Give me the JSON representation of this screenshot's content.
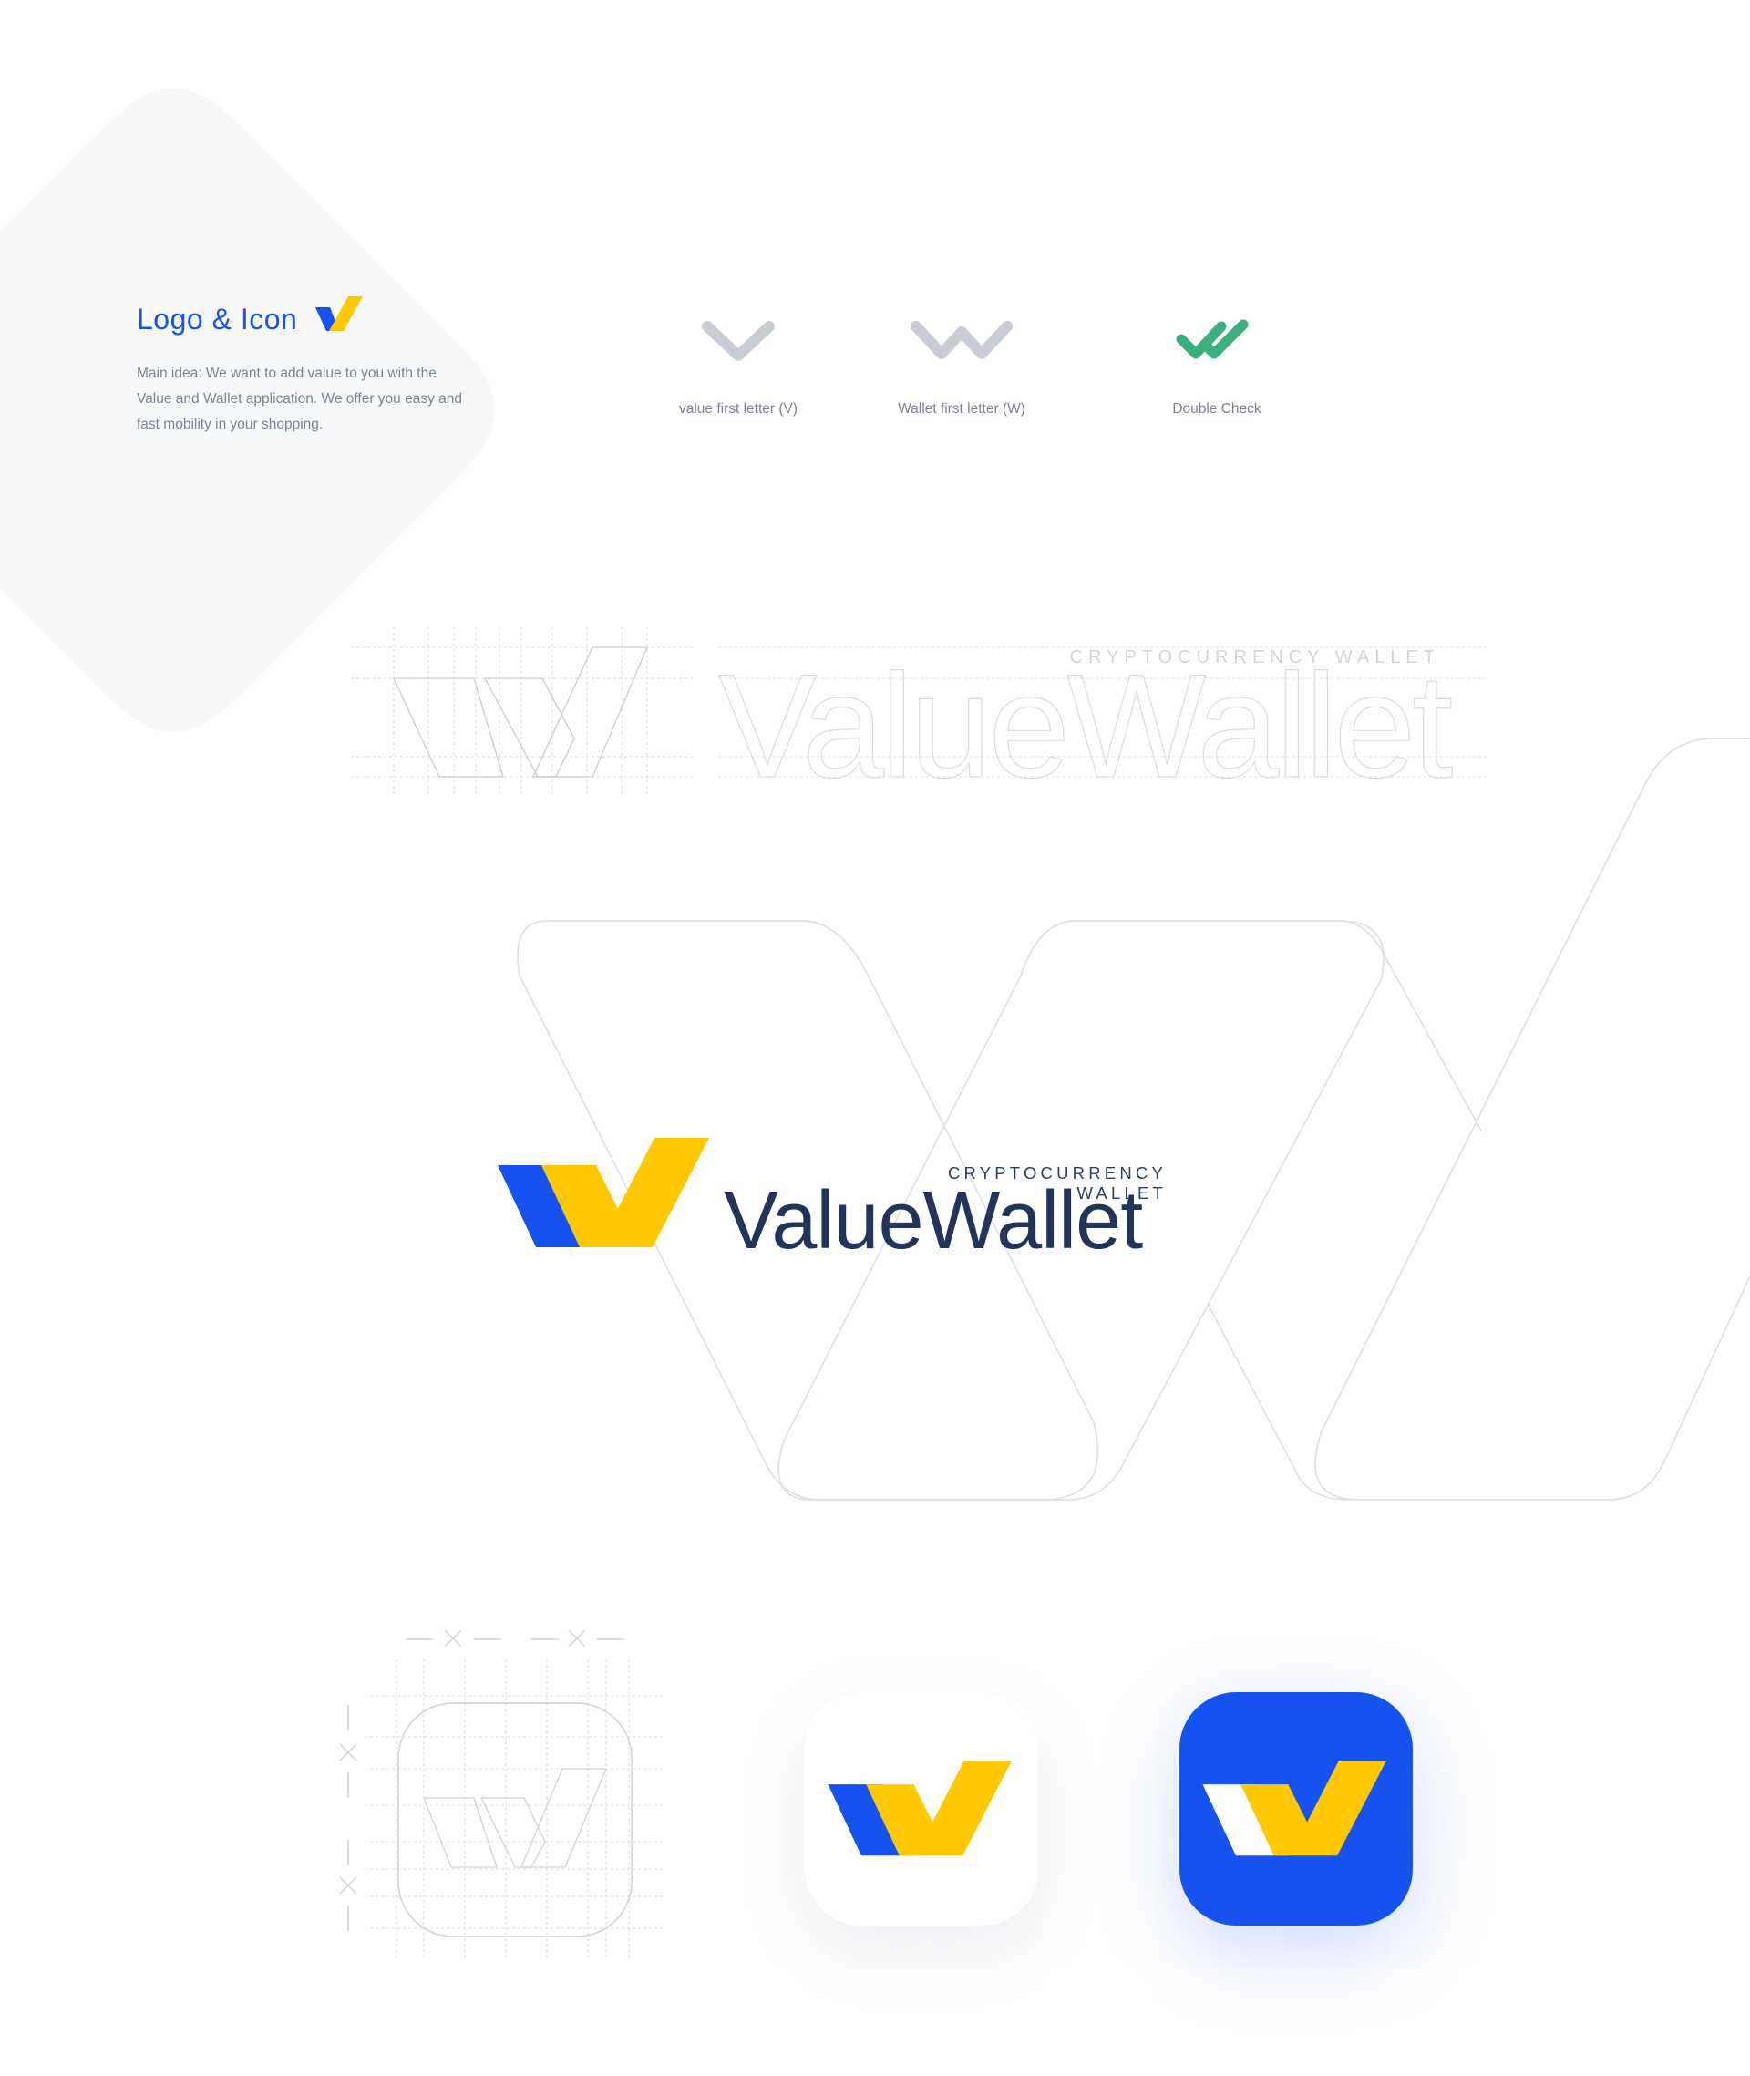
{
  "intro": {
    "title": "Logo & Icon",
    "description": "Main idea: We want to add value to you with the Value and Wallet application. We offer you easy and fast mobility in your shopping."
  },
  "concepts": [
    {
      "icon": "v-chevron-icon",
      "caption": "value first letter (V)"
    },
    {
      "icon": "w-chevron-icon",
      "caption": "Wallet first letter (W)"
    },
    {
      "icon": "double-check-icon",
      "caption": "Double Check"
    }
  ],
  "logo": {
    "subtitle": "CRYPTOCURRENCY WALLET",
    "wordmark": "ValueWallet"
  },
  "app_icons": [
    {
      "variant": "white",
      "background": "#ffffff"
    },
    {
      "variant": "blue",
      "background": "#1652f0"
    }
  ],
  "colors": {
    "brand_blue": "#1652f0",
    "brand_yellow": "#ffc800",
    "navy_text": "#23345a",
    "check_green": "#3bb07e",
    "muted_gray": "#c9ccd4"
  }
}
